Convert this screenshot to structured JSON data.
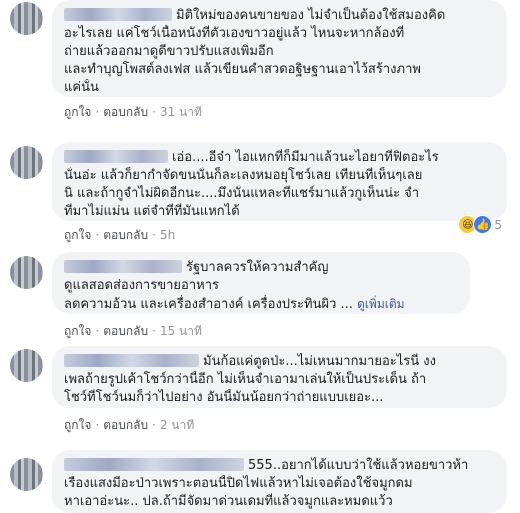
{
  "comments": [
    {
      "lines": [
        "มิติใหม่ของคนขายของ ไม่จำเป็นต้องใช้สมองคิด",
        "อะไรเลย แค่โชว์เนื้อหนังที่ตัวเองขาวอยู่แล้ว ไหนจะหากล้องที่",
        "ถ่ายแล้วออกมาดูดีขาวปรับแสงเพิ่มอีก",
        "และทำบุญโพสต์ลงเฟส แล้วเขียนคำสวดอฐิษฐานเอาไว้สร้างภาพ",
        "แค่นั้น"
      ],
      "actions": {
        "like": "ถูกใจ",
        "reply": "ตอบกลับ",
        "time": "31 นาที"
      }
    },
    {
      "lines": [
        "เอ่อ....อีจ๋า ไอแหกที่ก็มีมาแล้วนะไอยาที่ฟิตอะไร",
        "นั่นอ่ะ แล้วก็ยากำจัดขนนั่นก็ละเลงหมอยุโชว์เลย เทียนที่เห็นๆเลย",
        "นิ และถ้ากูจำไม่ผิดอีกนะ....มึงนั่นแหละที่แชร์มาแล้วกูเห็นน่ะ จำ",
        "ที่มาไม่แม่น แต่จำที่ที่มันแหกได้"
      ],
      "actions": {
        "like": "ถูกใจ",
        "reply": "ตอบกลับ",
        "time": "5h"
      },
      "reactions": {
        "icons": [
          "haha-icon",
          "like-icon"
        ],
        "count": "5"
      }
    },
    {
      "lines": [
        "รัฐบาลควรให้ความสำคัญ",
        "ดูแลสอดส่องการขายอาหาร",
        "ลดความอ้วน และเครื่องสำอางค์ เครื่องประทินผิว ..."
      ],
      "see_more": "ดูเพิ่มเติม",
      "actions": {
        "like": "ถูกใจ",
        "reply": "ตอบกลับ",
        "time": "15 นาที"
      }
    },
    {
      "lines": [
        "มันก้อแค่ตูดป่ะ...ไม่เหนมากมายอะไรนี่ งง",
        "เพลถ้ายรูปเค้าโชว์กว่านี้อีก ไม่เห็นจำเอามาเล่นให้เป็นประเด็น ถ้า",
        "โชว์ที่โชว์นมก็ว่าไปอย่าง อันนี้มันน้อยกว่าถ่ายแบบเยอะ..."
      ],
      "actions": {
        "like": "ถูกใจ",
        "reply": "ตอบกลับ",
        "time": "2 นาที"
      }
    },
    {
      "lines": [
        "555..อยากได้แบบว่าใช้แล้วหอยขาวห้า",
        "เรืองแสงมีอะป่าวเพราะตอนนี้ปิดไฟแล้วหาไม่เจอต้องใช้จมูกดม",
        "หาเอาอ่ะนะ.. ปล.ถ้ามีจัดมาด่วนเดมที่แล้วจมูกและหมดแว้ว"
      ]
    }
  ]
}
